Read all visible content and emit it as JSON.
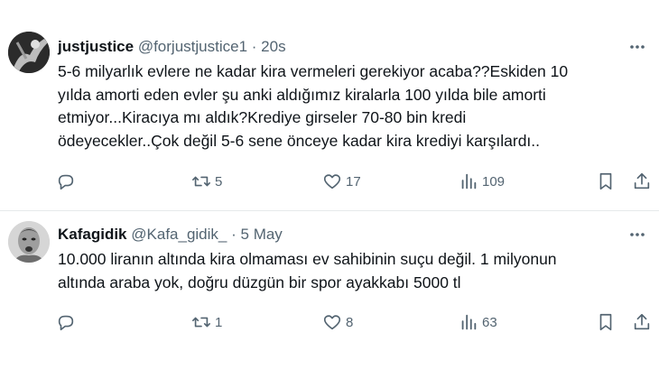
{
  "tweets": [
    {
      "name": "justjustice",
      "handle": "@forjustjustice1",
      "separator": "·",
      "time": "20s",
      "lines": [
        "5-6 milyarlık evlere ne kadar kira vermeleri gerekiyor acaba??Eskiden 10",
        "yılda amorti eden evler şu anki aldığımız kiralarla 100 yılda bile amorti",
        "etmiyor...Kiracıya mı aldık?Krediye girseler 70-80 bin kredi",
        "ödeyecekler..Çok değil 5-6 sene önceye kadar kira krediyi karşılardı.."
      ],
      "retweets": "5",
      "likes": "17",
      "views": "109"
    },
    {
      "name": "Kafagidik",
      "handle": "@Kafa_gidik_",
      "separator": "·",
      "time": "5 May",
      "lines": [
        "10.000 liranın altında kira olmaması ev sahibinin suçu değil. 1 milyonun",
        "altında araba yok, doğru düzgün bir spor ayakkabı 5000 tl"
      ],
      "retweets": "1",
      "likes": "8",
      "views": "63"
    }
  ],
  "icons": {
    "reply": "reply-icon",
    "retweet": "retweet-icon",
    "like": "heart-icon",
    "views": "views-icon",
    "bookmark": "bookmark-icon",
    "share": "share-icon",
    "more": "more-icon"
  },
  "colors": {
    "text": "#0f1419",
    "secondary": "#536471",
    "divider": "#e6e9eb"
  }
}
